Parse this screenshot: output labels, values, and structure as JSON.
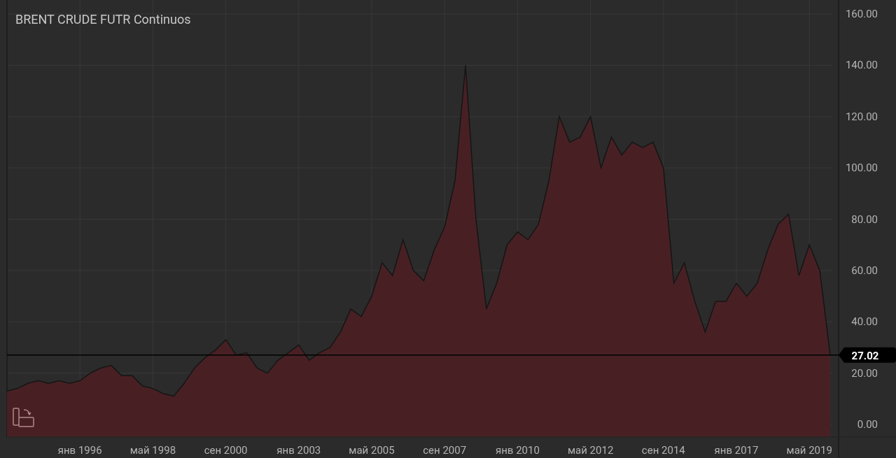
{
  "chart": {
    "chart_data": {
      "type": "area",
      "title": "BRENT CRUDE FUTR Continuos",
      "categories": [
        null,
        null,
        null,
        null,
        null,
        null,
        null,
        "янв 1996",
        null,
        null,
        null,
        null,
        null,
        null,
        "май 1998",
        null,
        null,
        null,
        null,
        null,
        null,
        "сен 2000",
        null,
        null,
        null,
        null,
        null,
        null,
        "янв 2003",
        null,
        null,
        null,
        null,
        null,
        null,
        "май 2005",
        null,
        null,
        null,
        null,
        null,
        null,
        "сен 2007",
        null,
        null,
        null,
        null,
        null,
        null,
        "янв 2010",
        null,
        null,
        null,
        null,
        null,
        null,
        "май 2012",
        null,
        null,
        null,
        null,
        null,
        null,
        "сен 2014",
        null,
        null,
        null,
        null,
        null,
        null,
        "янв 2017",
        null,
        null,
        null,
        null,
        null,
        null,
        "май 2019",
        null,
        null
      ],
      "series": [
        {
          "color": "#4a2024",
          "values": [
            13,
            14,
            16,
            17,
            16,
            17,
            16,
            17,
            20,
            22,
            23,
            19,
            19,
            15,
            14,
            12,
            11,
            16,
            22,
            26,
            29,
            33,
            27,
            28,
            22,
            20,
            25,
            28,
            31,
            25,
            28,
            30,
            36,
            45,
            42,
            50,
            63,
            58,
            72,
            60,
            56,
            68,
            77,
            95,
            140,
            80,
            45,
            55,
            70,
            75,
            72,
            78,
            95,
            120,
            110,
            112,
            120,
            100,
            112,
            105,
            110,
            108,
            110,
            100,
            55,
            63,
            48,
            36,
            48,
            48,
            55,
            50,
            55,
            68,
            78,
            82,
            58,
            70,
            60,
            27
          ]
        }
      ],
      "ylim": [
        0,
        160
      ],
      "yticks": [
        {
          "value": 0,
          "label": "0.00"
        },
        {
          "value": 20,
          "label": "20.00"
        },
        {
          "value": 40,
          "label": "40.00"
        },
        {
          "value": 60,
          "label": "60.00"
        },
        {
          "value": 80,
          "label": "80.00"
        },
        {
          "value": 100,
          "label": "100.00"
        },
        {
          "value": 120,
          "label": "120.00"
        },
        {
          "value": 140,
          "label": "140.00"
        },
        {
          "value": 160,
          "label": "160.00"
        }
      ],
      "grid": true,
      "ref_lines": [
        {
          "axis": "y",
          "value": 27.02,
          "label": "27.02",
          "color": "#000000"
        }
      ]
    }
  }
}
